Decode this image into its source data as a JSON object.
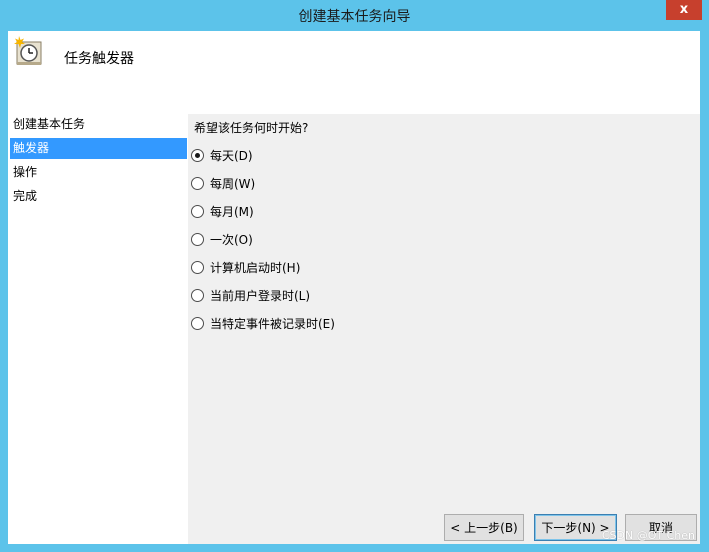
{
  "window": {
    "title": "创建基本任务向导",
    "close_label": "x"
  },
  "header": {
    "title": "任务触发器",
    "icon": "clock-task-icon"
  },
  "sidebar": {
    "items": [
      {
        "label": "创建基本任务",
        "selected": false
      },
      {
        "label": "触发器",
        "selected": true
      },
      {
        "label": "操作",
        "selected": false
      },
      {
        "label": "完成",
        "selected": false
      }
    ]
  },
  "main": {
    "question": "希望该任务何时开始?",
    "options": [
      {
        "label": "每天(D)",
        "checked": true
      },
      {
        "label": "每周(W)",
        "checked": false
      },
      {
        "label": "每月(M)",
        "checked": false
      },
      {
        "label": "一次(O)",
        "checked": false
      },
      {
        "label": "计算机启动时(H)",
        "checked": false
      },
      {
        "label": "当前用户登录时(L)",
        "checked": false
      },
      {
        "label": "当特定事件被记录时(E)",
        "checked": false
      }
    ]
  },
  "buttons": {
    "back": "< 上一步(B)",
    "next": "下一步(N) >",
    "cancel": "取消"
  },
  "watermark": "CSDN @OT Chen",
  "colors": {
    "title_bar": "#5cc3ea",
    "selection": "#3399ff",
    "close": "#c7402d"
  }
}
